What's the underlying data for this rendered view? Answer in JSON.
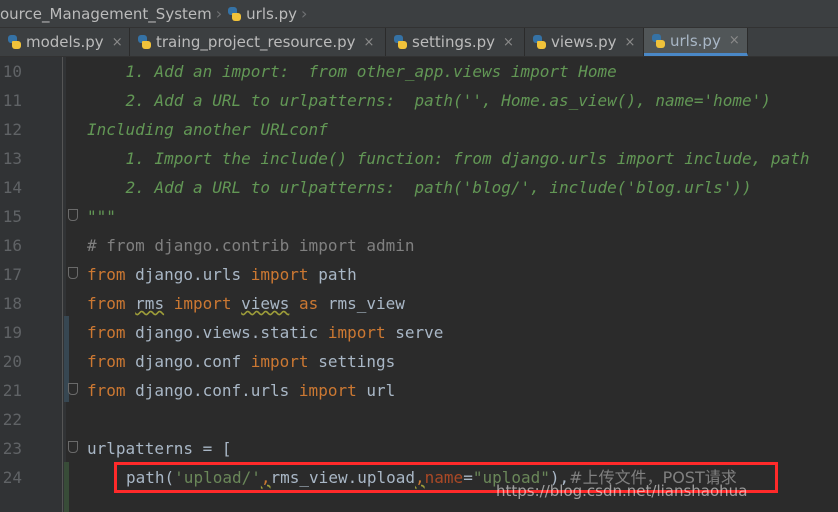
{
  "breadcrumb": {
    "project": "ource_Management_System",
    "file": "urls.py"
  },
  "tabs": [
    {
      "label": "models.py",
      "close": "×",
      "active": false
    },
    {
      "label": "traing_project_resource.py",
      "close": "×",
      "active": false
    },
    {
      "label": "settings.py",
      "close": "×",
      "active": false
    },
    {
      "label": "views.py",
      "close": "×",
      "active": false
    },
    {
      "label": "urls.py",
      "close": "×",
      "active": true
    }
  ],
  "code": {
    "line_numbers": [
      "10",
      "11",
      "12",
      "13",
      "14",
      "15",
      "16",
      "17",
      "18",
      "19",
      "20",
      "21",
      "22",
      "23",
      "24"
    ],
    "l10": "    1. Add an import:  from other_app.views import Home",
    "l11": "    2. Add a URL to urlpatterns:  path('', Home.as_view(), name='home')",
    "l12": "Including another URLconf",
    "l13": "    1. Import the include() function: from django.urls import include, path",
    "l14": "    2. Add a URL to urlpatterns:  path('blog/', include('blog.urls'))",
    "l15": "\"\"\"",
    "l16": "# from django.contrib import admin",
    "l17": {
      "a": "from",
      "b": " django.urls ",
      "c": "import",
      "d": " path"
    },
    "l18": {
      "a": "from",
      "b": " ",
      "m1": "rms",
      "c": " ",
      "k2": "import",
      "d": " ",
      "m2": "views",
      "e": " ",
      "k3": "as",
      "f": " rms_view"
    },
    "l19": {
      "a": "from",
      "b": " django.views.static ",
      "c": "import",
      "d": " serve"
    },
    "l20": {
      "a": "from",
      "b": " django.conf ",
      "c": "import",
      "d": " settings"
    },
    "l21": {
      "a": "from",
      "b": " django.conf.urls ",
      "c": "import",
      "d": " url"
    },
    "l23": "urlpatterns = [",
    "l24": {
      "fn": "path(",
      "s1": "'upload/'",
      "comma1": ",",
      "mid": "rms_view.upload",
      "comma2": ",",
      "kw": "name",
      "eq": "=",
      "s2": "\"upload\"",
      "end": "),",
      "comment": "#上传文件，POST请求"
    }
  },
  "watermark": "https://blog.csdn.net/lianshaohua",
  "colors": {
    "keyword": "#cc7832",
    "string": "#6a8759",
    "docstring": "#629755",
    "comment": "#808080",
    "highlight": "#ff2a2a"
  }
}
